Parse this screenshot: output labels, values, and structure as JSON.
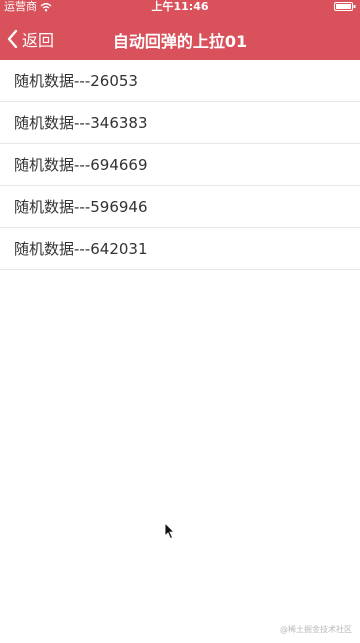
{
  "status_bar": {
    "carrier": "运营商",
    "time": "上午11:46"
  },
  "nav": {
    "back_label": "返回",
    "title": "自动回弹的上拉01"
  },
  "list": [
    "随机数据---26053",
    "随机数据---346383",
    "随机数据---694669",
    "随机数据---596946",
    "随机数据---642031"
  ],
  "watermark": "@稀土掘金技术社区",
  "colors": {
    "header": "#d9525b",
    "text": "#333333",
    "divider": "#e8e8e8"
  }
}
